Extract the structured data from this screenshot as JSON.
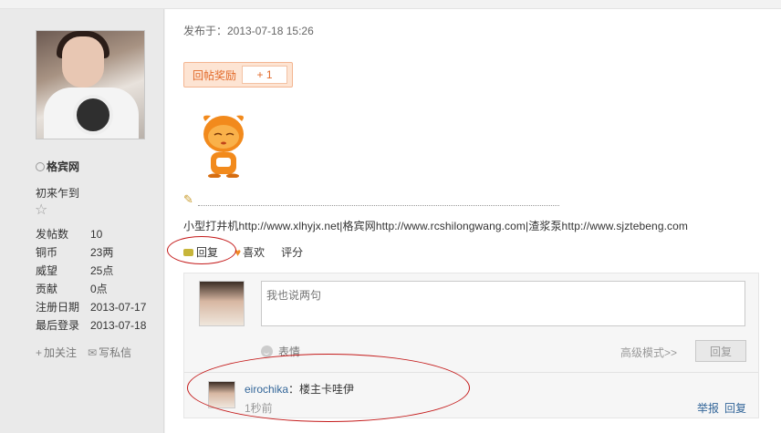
{
  "sidebar": {
    "username": "格宾网",
    "rank": "初来乍到",
    "stats": [
      {
        "label": "发帖数",
        "value": "10"
      },
      {
        "label": "铜币",
        "value": "23两"
      },
      {
        "label": "威望",
        "value": "25点"
      },
      {
        "label": "贡献",
        "value": "0点"
      },
      {
        "label": "注册日期",
        "value": "2013-07-17"
      },
      {
        "label": "最后登录",
        "value": "2013-07-18"
      }
    ],
    "follow_label": "加关注",
    "message_label": "写私信"
  },
  "post": {
    "posted_at": "发布于：2013-07-18 15:26",
    "reward_label": "回帖奖励",
    "reward_count": "+ 1",
    "signature": "小型打井机http://www.xlhyjx.net|格宾网http://www.rcshilongwang.com|渣浆泵http://www.sjztebeng.com",
    "actions": {
      "reply": "回复",
      "like": "喜欢",
      "rate": "评分"
    }
  },
  "reply_box": {
    "placeholder": "我也说两句",
    "emoji_label": "表情",
    "advanced_label": "高级模式>>",
    "submit_label": "回复"
  },
  "comment": {
    "author": "eirochika",
    "separator": "：",
    "text": "楼主卡哇伊",
    "time": "1秒前",
    "report_label": "举报",
    "reply_label": "回复"
  },
  "colors": {
    "link": "#336699",
    "reward_text": "#e26a2a",
    "highlight": "#c41a1a"
  }
}
